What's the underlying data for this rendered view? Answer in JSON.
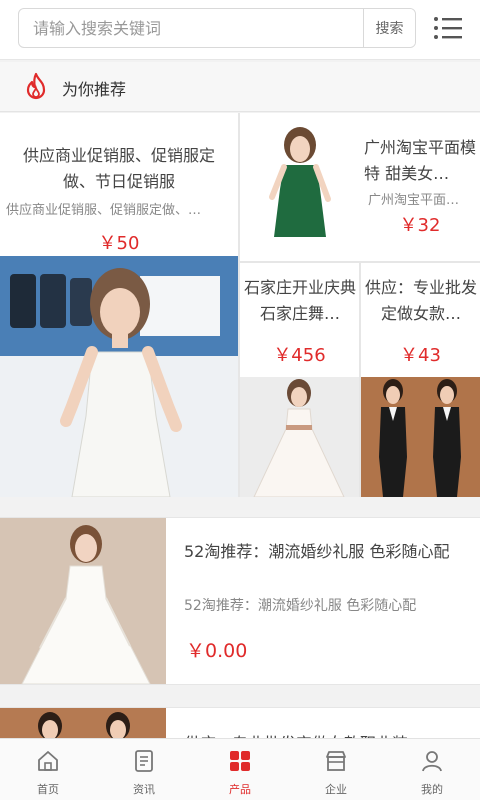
{
  "search": {
    "placeholder": "请输入搜索关键词",
    "button": "搜索"
  },
  "section": {
    "title": "为你推荐"
  },
  "grid": {
    "p1": {
      "title": "供应商业促销服、促销服定做、节日促销服",
      "sub": "供应商业促销服、促销服定做、…",
      "price": "￥50"
    },
    "p2": {
      "title": "广州淘宝平面模特 甜美女…",
      "sub": "广州淘宝平面…",
      "price": "￥32"
    },
    "p3": {
      "title": "石家庄开业庆典 石家庄舞…",
      "price": "￥456"
    },
    "p4": {
      "title": "供应：专业批发定做女款…",
      "price": "￥43"
    }
  },
  "list": [
    {
      "title": "52淘推荐：潮流婚纱礼服 色彩随心配",
      "sub": "52淘推荐：潮流婚纱礼服 色彩随心配",
      "price": "￥0.00"
    },
    {
      "title": "供应：专业批发定做女款职业装"
    }
  ],
  "nav": [
    {
      "label": "首页",
      "icon": "home-icon"
    },
    {
      "label": "资讯",
      "icon": "news-icon"
    },
    {
      "label": "产品",
      "icon": "product-icon"
    },
    {
      "label": "企业",
      "icon": "company-icon"
    },
    {
      "label": "我的",
      "icon": "user-icon"
    }
  ],
  "colors": {
    "accent": "#e02b2b",
    "background": "#f2f2f2"
  }
}
